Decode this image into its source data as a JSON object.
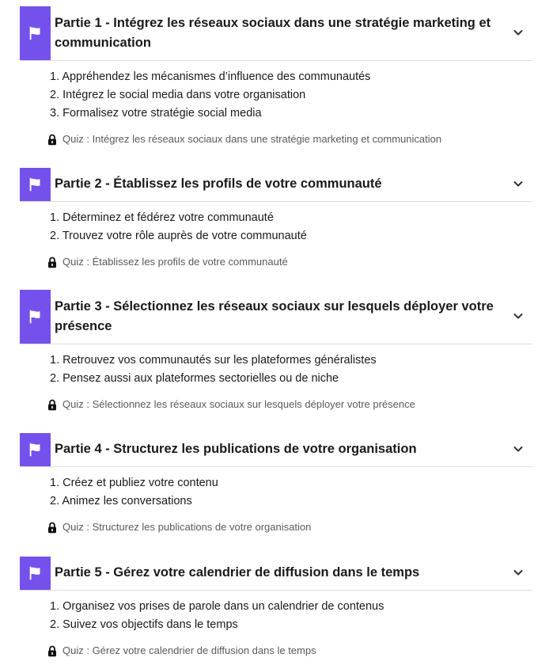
{
  "accent_color": "#7451eb",
  "icons": {
    "part_icon": "flag-icon",
    "toggle_icon": "chevron-down-icon",
    "quiz_icon": "lock-icon"
  },
  "parts": [
    {
      "title": "Partie 1 - Intégrez les réseaux sociaux dans une stratégie marketing et communication",
      "chapters": [
        "1. Appréhendez les mécanismes d’influence des communautés",
        "2. Intégrez le social media dans votre organisation",
        "3. Formalisez votre stratégie social media"
      ],
      "quiz": "Quiz : Intégrez les réseaux sociaux dans une stratégie marketing et communication"
    },
    {
      "title": "Partie 2 - Établissez les profils de votre communauté",
      "chapters": [
        "1. Déterminez et fédérez votre communauté",
        "2. Trouvez votre rôle auprès de votre communauté"
      ],
      "quiz": "Quiz : Établissez les profils de votre communauté"
    },
    {
      "title": "Partie 3 - Sélectionnez les réseaux sociaux sur lesquels déployer votre présence",
      "chapters": [
        "1. Retrouvez vos communautés sur les plateformes généralistes",
        "2. Pensez aussi aux plateformes sectorielles ou de niche"
      ],
      "quiz": "Quiz : Sélectionnez les réseaux sociaux sur lesquels déployer votre présence"
    },
    {
      "title": "Partie 4 - Structurez les publications de votre organisation",
      "chapters": [
        "1. Créez et publiez votre contenu",
        "2. Animez les conversations"
      ],
      "quiz": "Quiz : Structurez les publications de votre organisation"
    },
    {
      "title": "Partie 5 - Gérez votre calendrier de diffusion dans le temps",
      "chapters": [
        "1. Organisez vos prises de parole dans un calendrier de contenus",
        "2. Suivez vos objectifs dans le temps"
      ],
      "quiz": "Quiz : Gérez votre calendrier de diffusion dans le temps"
    }
  ]
}
